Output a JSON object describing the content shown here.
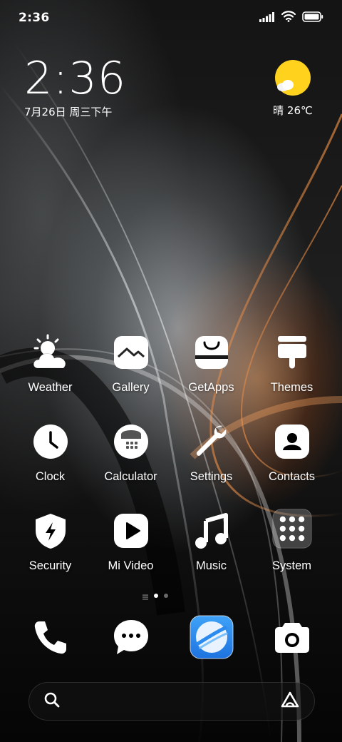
{
  "status_bar": {
    "time": "2:36",
    "icons": [
      "signal-icon",
      "wifi-icon",
      "battery-icon"
    ]
  },
  "clock_widget": {
    "time": "2:36",
    "date": "7月26日 周三下午"
  },
  "weather_widget": {
    "condition_icon": "sunny-partly-cloudy-icon",
    "text": "晴 26℃"
  },
  "apps": [
    {
      "label": "Weather",
      "icon": "weather-icon"
    },
    {
      "label": "Gallery",
      "icon": "gallery-icon"
    },
    {
      "label": "GetApps",
      "icon": "getapps-icon"
    },
    {
      "label": "Themes",
      "icon": "themes-icon"
    },
    {
      "label": "Clock",
      "icon": "clock-icon"
    },
    {
      "label": "Calculator",
      "icon": "calculator-icon"
    },
    {
      "label": "Settings",
      "icon": "settings-icon"
    },
    {
      "label": "Contacts",
      "icon": "contacts-icon"
    },
    {
      "label": "Security",
      "icon": "security-icon"
    },
    {
      "label": "Mi Video",
      "icon": "mi-video-icon"
    },
    {
      "label": "Music",
      "icon": "music-icon"
    },
    {
      "label": "System",
      "icon": "system-folder-icon"
    }
  ],
  "page_indicator": {
    "pages": 2,
    "current": 1
  },
  "dock": [
    {
      "icon": "phone-icon"
    },
    {
      "icon": "messages-icon"
    },
    {
      "icon": "browser-icon"
    },
    {
      "icon": "camera-icon"
    }
  ],
  "search_bar": {
    "left_icon": "search-icon",
    "right_icon": "assistant-icon"
  },
  "colors": {
    "sun": "#FFD21E",
    "browser_blue": "#2B8BEF",
    "icon_white": "#FFFFFF"
  }
}
